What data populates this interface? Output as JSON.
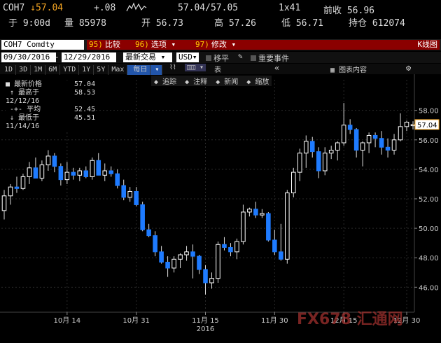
{
  "quote": {
    "ticker": "COH7",
    "last": "57.04",
    "change": "+.08",
    "bid_ask": "57.04/57.05",
    "size": "1x41",
    "prev_close_label": "前收",
    "prev_close": "56.96",
    "time": "于 9:00d",
    "volume_label": "量",
    "volume": "85978",
    "open_label": "开",
    "open": "56.73",
    "high_label": "高",
    "high": "57.26",
    "low_label": "低",
    "low": "56.71",
    "oi_label": "持仓",
    "oi": "612074"
  },
  "toolbar1": {
    "security": "COH7 Comdty",
    "compare_num": "95)",
    "compare_label": "比较",
    "options_num": "96)",
    "options_label": "选项",
    "edit_num": "97)",
    "edit_label": "修改",
    "chart_type": "K线图"
  },
  "toolbar2": {
    "start_date": "09/30/2016",
    "end_date": "12/29/2016",
    "trade_label": "最新交易",
    "currency": "USD",
    "smooth_label": "移平",
    "events_label": "重要事件"
  },
  "toolbar3": {
    "ranges": [
      "1D",
      "3D",
      "1M",
      "6M",
      "YTD",
      "1Y",
      "5Y",
      "Max"
    ],
    "period": "每日",
    "table_label": "表",
    "chart_content_label": "图表内容"
  },
  "tools": {
    "track": "追踪",
    "annotate": "注释",
    "news": "新闻",
    "zoom": "缩放"
  },
  "legend": {
    "last_label": "最新价格",
    "last_value": "57.04",
    "high_label": "最高于 12/12/16",
    "high_value": "58.53",
    "avg_label": "平均",
    "avg_value": "52.45",
    "low_label": "最低于 11/14/16",
    "low_value": "45.51"
  },
  "watermark": "FX678 汇通网",
  "chart_data": {
    "type": "candlestick",
    "y_ticks": [
      "58.00",
      "56.00",
      "54.00",
      "52.00",
      "50.00",
      "48.00",
      "46.00"
    ],
    "ylim": [
      44.4,
      59.6
    ],
    "x_ticks": [
      {
        "index": 10,
        "label": "10月 14"
      },
      {
        "index": 21,
        "label": "10月 31"
      },
      {
        "index": 32,
        "label": "11月 15",
        "sub": "2016"
      },
      {
        "index": 43,
        "label": "11月 30"
      },
      {
        "index": 54,
        "label": "12月 15"
      },
      {
        "index": 64,
        "label": "12月 30"
      }
    ],
    "last_price_tag": "57.04",
    "colors": {
      "up": "#ffffff",
      "down": "#1e7bff",
      "tag": "#f5a623"
    },
    "candles": [
      [
        51.2,
        52.6,
        50.6,
        52.2
      ],
      [
        52.2,
        53.0,
        51.6,
        52.8
      ],
      [
        52.8,
        53.5,
        52.4,
        52.7
      ],
      [
        52.7,
        53.7,
        52.6,
        53.5
      ],
      [
        53.5,
        54.5,
        53.0,
        54.1
      ],
      [
        54.1,
        54.8,
        53.6,
        53.4
      ],
      [
        53.4,
        54.6,
        53.2,
        54.3
      ],
      [
        54.3,
        55.3,
        53.9,
        54.9
      ],
      [
        54.9,
        55.1,
        53.8,
        54.2
      ],
      [
        54.2,
        54.4,
        52.9,
        53.3
      ],
      [
        53.3,
        54.5,
        53.0,
        53.8
      ],
      [
        53.8,
        54.1,
        53.3,
        53.6
      ],
      [
        53.6,
        54.1,
        53.2,
        53.9
      ],
      [
        53.9,
        54.2,
        53.4,
        53.5
      ],
      [
        53.5,
        54.8,
        53.3,
        54.6
      ],
      [
        54.6,
        55.1,
        53.7,
        53.6
      ],
      [
        53.6,
        54.4,
        53.2,
        53.9
      ],
      [
        53.9,
        54.2,
        53.5,
        53.7
      ],
      [
        53.7,
        54.0,
        52.7,
        52.9
      ],
      [
        52.9,
        53.3,
        51.9,
        52.1
      ],
      [
        52.1,
        52.8,
        51.8,
        52.5
      ],
      [
        52.5,
        52.8,
        51.5,
        51.6
      ],
      [
        51.6,
        51.8,
        49.8,
        49.9
      ],
      [
        49.9,
        50.3,
        49.4,
        49.5
      ],
      [
        49.5,
        49.8,
        48.1,
        48.4
      ],
      [
        48.4,
        48.8,
        47.6,
        47.7
      ],
      [
        47.7,
        48.1,
        46.7,
        47.3
      ],
      [
        47.3,
        48.1,
        47.0,
        47.9
      ],
      [
        47.9,
        48.3,
        47.3,
        48.2
      ],
      [
        48.2,
        48.8,
        47.8,
        48.4
      ],
      [
        48.4,
        48.9,
        46.6,
        48.1
      ],
      [
        48.1,
        48.2,
        46.9,
        47.2
      ],
      [
        47.2,
        47.5,
        45.5,
        46.3
      ],
      [
        46.3,
        47.0,
        45.9,
        46.6
      ],
      [
        46.6,
        49.1,
        46.3,
        48.9
      ],
      [
        48.9,
        49.4,
        48.5,
        48.7
      ],
      [
        48.7,
        49.0,
        48.1,
        48.4
      ],
      [
        48.4,
        49.3,
        47.9,
        49.1
      ],
      [
        49.1,
        51.6,
        48.9,
        51.1
      ],
      [
        51.1,
        51.4,
        50.8,
        51.3
      ],
      [
        51.3,
        51.8,
        50.7,
        50.9
      ],
      [
        50.9,
        51.3,
        50.7,
        51.0
      ],
      [
        51.0,
        51.1,
        49.1,
        49.2
      ],
      [
        49.2,
        49.9,
        48.2,
        48.4
      ],
      [
        48.4,
        50.3,
        47.8,
        47.9
      ],
      [
        47.9,
        52.6,
        47.6,
        52.4
      ],
      [
        52.4,
        54.1,
        52.1,
        53.8
      ],
      [
        53.8,
        55.4,
        53.2,
        55.1
      ],
      [
        55.1,
        56.3,
        54.1,
        55.9
      ],
      [
        55.9,
        56.2,
        54.8,
        55.2
      ],
      [
        55.2,
        55.5,
        53.4,
        53.9
      ],
      [
        53.9,
        55.5,
        53.6,
        55.1
      ],
      [
        55.1,
        55.6,
        54.7,
        55.3
      ],
      [
        55.3,
        55.9,
        54.6,
        55.8
      ],
      [
        55.8,
        58.5,
        55.6,
        57.0
      ],
      [
        57.0,
        57.4,
        56.4,
        56.7
      ],
      [
        56.7,
        56.8,
        54.8,
        55.3
      ],
      [
        55.3,
        55.9,
        54.2,
        55.8
      ],
      [
        55.8,
        56.5,
        55.1,
        56.3
      ],
      [
        56.3,
        56.5,
        55.5,
        56.1
      ],
      [
        56.1,
        56.6,
        55.0,
        55.5
      ],
      [
        55.5,
        56.1,
        54.8,
        55.3
      ],
      [
        55.3,
        56.4,
        55.0,
        56.0
      ],
      [
        56.0,
        57.8,
        55.9,
        56.9
      ],
      [
        56.9,
        57.3,
        56.6,
        57.2
      ],
      [
        56.96,
        57.26,
        56.71,
        57.04
      ]
    ]
  }
}
